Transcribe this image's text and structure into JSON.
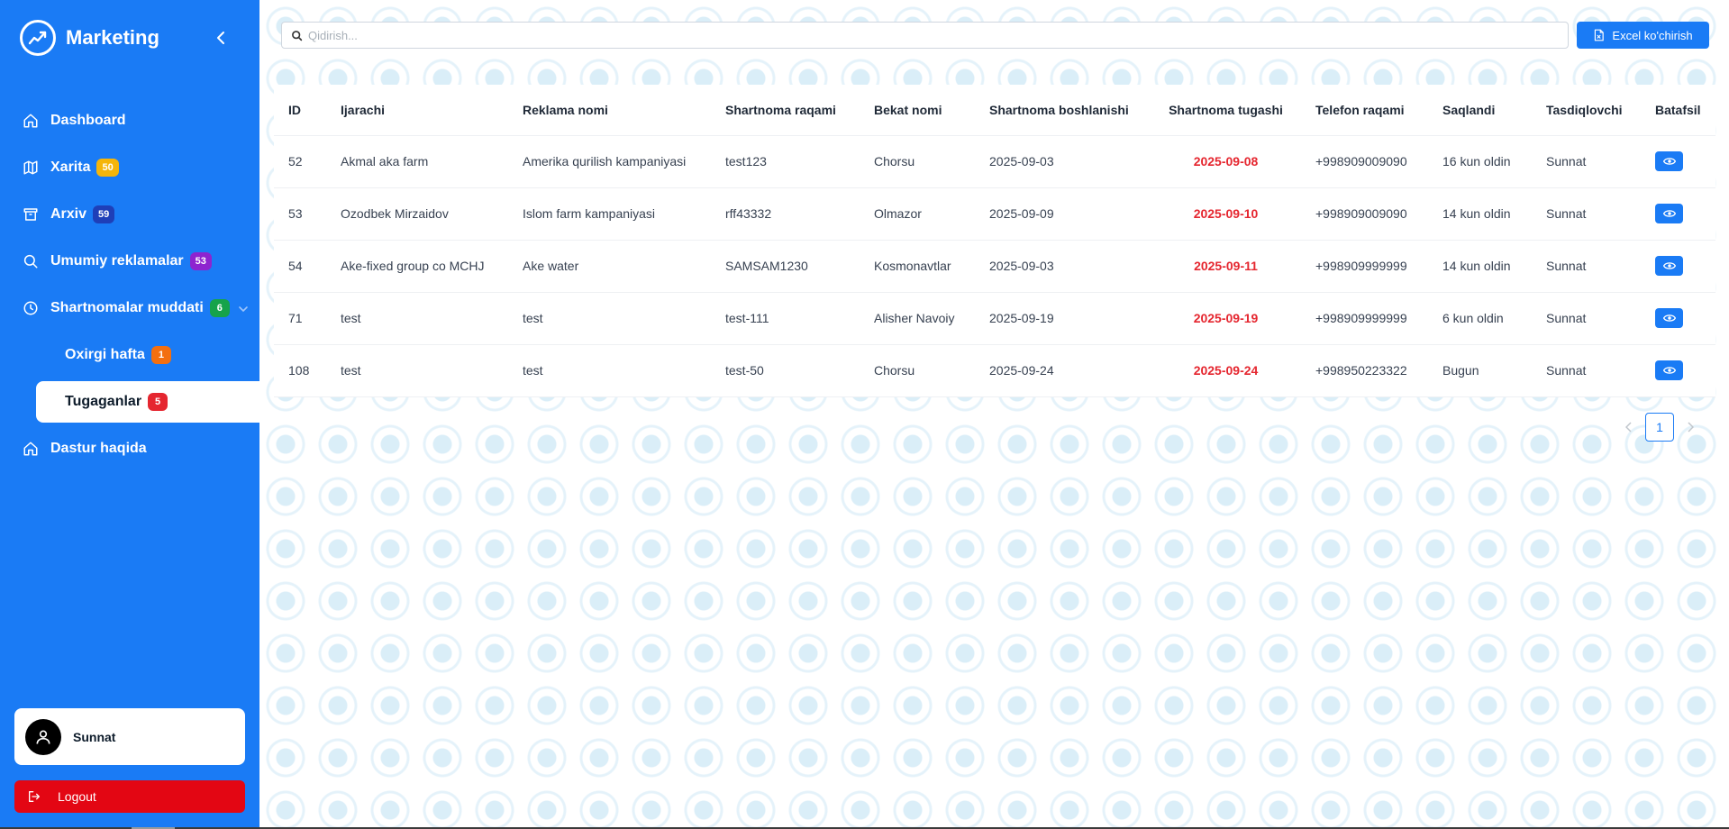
{
  "brand": {
    "title": "Marketing"
  },
  "nav": {
    "items": [
      {
        "label": "Dashboard",
        "icon": "home-icon"
      },
      {
        "label": "Xarita",
        "icon": "map-icon",
        "badge": "50",
        "badge_color": "#f5b50a"
      },
      {
        "label": "Arxiv",
        "icon": "archive-icon",
        "badge": "59",
        "badge_color": "#1e3fb8"
      },
      {
        "label": "Umumiy reklamalar",
        "icon": "search-icon",
        "badge": "53",
        "badge_color": "#8e24cf"
      },
      {
        "label": "Shartnomalar muddati",
        "icon": "clock-icon",
        "badge": "6",
        "badge_color": "#16a34a"
      },
      {
        "label": "Oxirgi hafta",
        "badge": "1",
        "badge_color": "#f36f0f"
      },
      {
        "label": "Tugaganlar",
        "badge": "5",
        "badge_color": "#e5262f"
      },
      {
        "label": "Dastur haqida",
        "icon": "home-icon"
      }
    ]
  },
  "user": {
    "name": "Sunnat"
  },
  "logout": {
    "label": "Logout"
  },
  "search": {
    "placeholder": "Qidirish..."
  },
  "excel": {
    "label": "Excel ko'chirish"
  },
  "table": {
    "headers": [
      "ID",
      "Ijarachi",
      "Reklama nomi",
      "Shartnoma raqami",
      "Bekat nomi",
      "Shartnoma boshlanishi",
      "Shartnoma tugashi",
      "Telefon raqami",
      "Saqlandi",
      "Tasdiqlovchi",
      "Batafsil"
    ],
    "rows": [
      [
        "52",
        "Akmal aka farm",
        "Amerika qurilish kampaniyasi",
        "test123",
        "Chorsu",
        "2025-09-03",
        "2025-09-08",
        "+998909009090",
        "16 kun oldin",
        "Sunnat"
      ],
      [
        "53",
        "Ozodbek Mirzaidov",
        "Islom farm kampaniyasi",
        "rff43332",
        "Olmazor",
        "2025-09-09",
        "2025-09-10",
        "+998909009090",
        "14 kun oldin",
        "Sunnat"
      ],
      [
        "54",
        "Ake-fixed group co MCHJ",
        "Ake water",
        "SAMSAM1230",
        "Kosmonavtlar",
        "2025-09-03",
        "2025-09-11",
        "+998909999999",
        "14 kun oldin",
        "Sunnat"
      ],
      [
        "71",
        "test",
        "test",
        "test-111",
        "Alisher Navoiy",
        "2025-09-19",
        "2025-09-19",
        "+998909999999",
        "6 kun oldin",
        "Sunnat"
      ],
      [
        "108",
        "test",
        "test",
        "test-50",
        "Chorsu",
        "2025-09-24",
        "2025-09-24",
        "+998950223322",
        "Bugun",
        "Sunnat"
      ]
    ]
  },
  "pagination": {
    "current": "1"
  },
  "colors": {
    "primary": "#1a7bf5",
    "danger": "#e30613",
    "end_date": "#e5262f"
  }
}
